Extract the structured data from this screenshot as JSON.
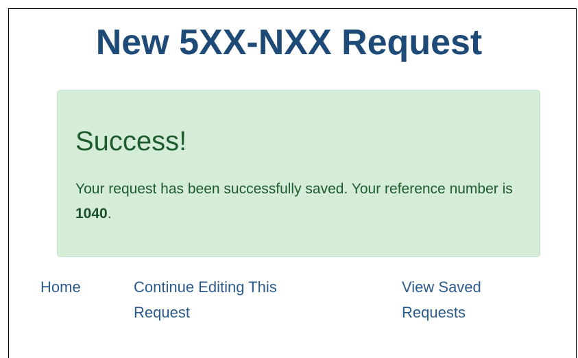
{
  "page": {
    "title": "New 5XX-NXX Request"
  },
  "alert": {
    "heading": "Success!",
    "message_before": "Your request has been successfully saved. Your reference number is ",
    "reference_number": "1040",
    "message_after": ".",
    "colors": {
      "background": "#d5ecd9",
      "text": "#1e5c2e"
    }
  },
  "nav": {
    "home_label": "Home",
    "continue_label": "Continue Editing This Request",
    "saved_label": "View Saved Requests"
  },
  "colors": {
    "title": "#1e4a78",
    "link": "#2a5b8c"
  }
}
